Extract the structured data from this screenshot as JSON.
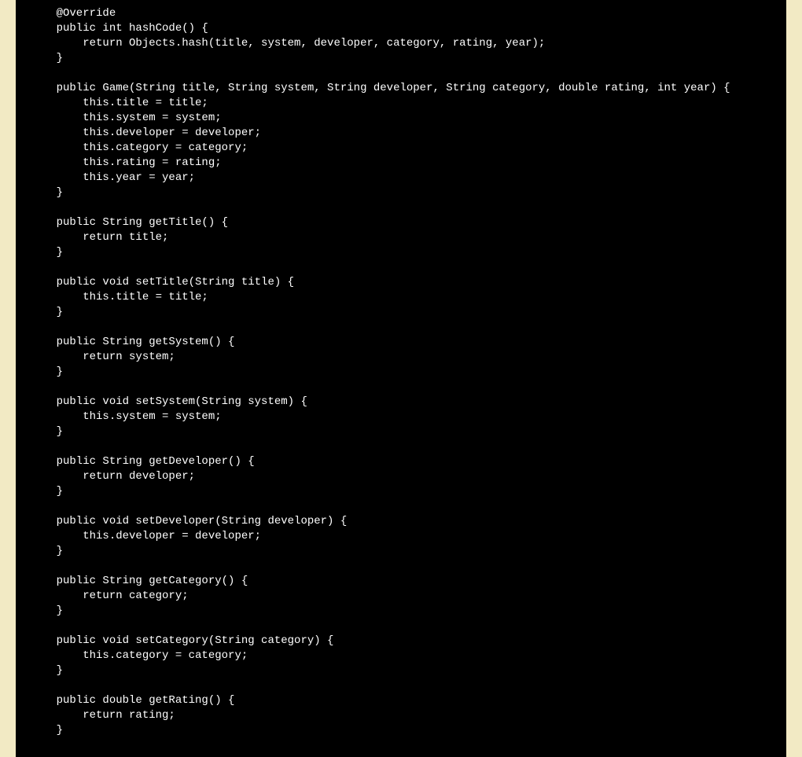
{
  "code": {
    "lines": [
      "    @Override",
      "    public int hashCode() {",
      "        return Objects.hash(title, system, developer, category, rating, year);",
      "    }",
      "",
      "    public Game(String title, String system, String developer, String category, double rating, int year) {",
      "        this.title = title;",
      "        this.system = system;",
      "        this.developer = developer;",
      "        this.category = category;",
      "        this.rating = rating;",
      "        this.year = year;",
      "    }",
      "",
      "    public String getTitle() {",
      "        return title;",
      "    }",
      "",
      "    public void setTitle(String title) {",
      "        this.title = title;",
      "    }",
      "",
      "    public String getSystem() {",
      "        return system;",
      "    }",
      "",
      "    public void setSystem(String system) {",
      "        this.system = system;",
      "    }",
      "",
      "    public String getDeveloper() {",
      "        return developer;",
      "    }",
      "",
      "    public void setDeveloper(String developer) {",
      "        this.developer = developer;",
      "    }",
      "",
      "    public String getCategory() {",
      "        return category;",
      "    }",
      "",
      "    public void setCategory(String category) {",
      "        this.category = category;",
      "    }",
      "",
      "    public double getRating() {",
      "        return rating;",
      "    }"
    ]
  }
}
